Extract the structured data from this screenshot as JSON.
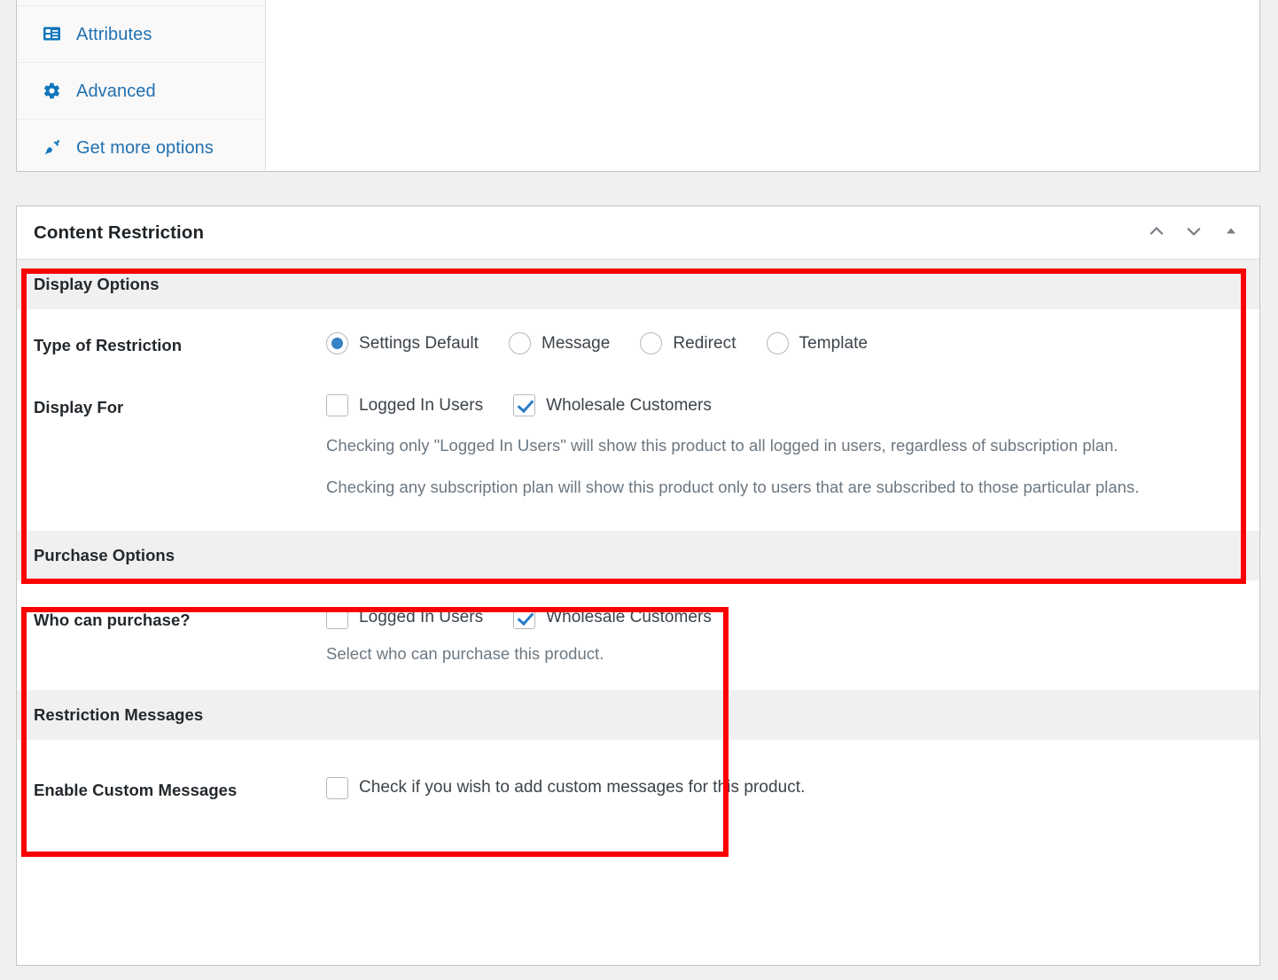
{
  "product_data_tabs": {
    "items": [
      {
        "label": "Attributes",
        "icon": "attributes-icon"
      },
      {
        "label": "Advanced",
        "icon": "gear-icon"
      },
      {
        "label": "Get more options",
        "icon": "plugin-icon"
      }
    ]
  },
  "content_restriction": {
    "title": "Content Restriction",
    "header_actions": [
      {
        "name": "move-up-button",
        "icon": "chevron-up-icon"
      },
      {
        "name": "move-down-button",
        "icon": "chevron-down-icon"
      },
      {
        "name": "toggle-panel-button",
        "icon": "triangle-up-icon"
      }
    ],
    "sections": {
      "display_options": {
        "band_title": "Display Options",
        "type_of_restriction": {
          "label": "Type of Restriction",
          "options": [
            {
              "label": "Settings Default",
              "checked": true
            },
            {
              "label": "Message",
              "checked": false
            },
            {
              "label": "Redirect",
              "checked": false
            },
            {
              "label": "Template",
              "checked": false
            }
          ]
        },
        "display_for": {
          "label": "Display For",
          "options": [
            {
              "label": "Logged In Users",
              "checked": false
            },
            {
              "label": "Wholesale Customers",
              "checked": true
            }
          ],
          "help_1": "Checking only \"Logged In Users\" will show this product to all logged in users, regardless of subscription plan.",
          "help_2": "Checking any subscription plan will show this product only to users that are subscribed to those particular plans."
        }
      },
      "purchase_options": {
        "band_title": "Purchase Options",
        "who_can_purchase": {
          "label": "Who can purchase?",
          "options": [
            {
              "label": "Logged In Users",
              "checked": false
            },
            {
              "label": "Wholesale Customers",
              "checked": true
            }
          ],
          "help": "Select who can purchase this product."
        }
      },
      "restriction_messages": {
        "band_title": "Restriction Messages",
        "enable_custom_messages": {
          "label": "Enable Custom Messages",
          "checkbox_label": "Check if you wish to add custom messages for this product.",
          "checked": false
        }
      }
    }
  },
  "colors": {
    "link_blue": "#2271b1",
    "accent_blue": "#3582c4",
    "annotation_red": "#fb0000",
    "band_gray": "#f0f0f0",
    "page_background": "#f0f0f1"
  }
}
